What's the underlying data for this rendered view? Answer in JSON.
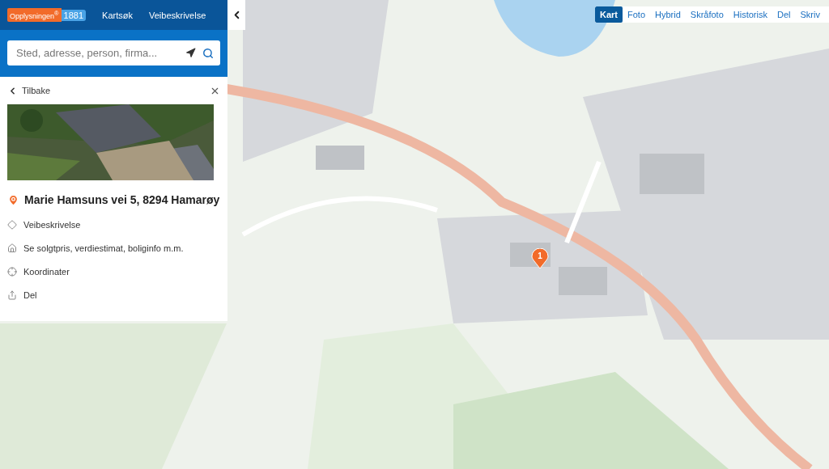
{
  "header": {
    "logo": {
      "name": "Opplysningen",
      "mark": "®",
      "number": "1881"
    },
    "nav": [
      "Kartsøk",
      "Veibeskrivelse"
    ]
  },
  "search": {
    "placeholder": "Sted, adresse, person, firma..."
  },
  "panel": {
    "back": "Tilbake",
    "address": "Marie Hamsuns vei 5, 8294 Hamarøy",
    "actions": [
      {
        "kind": "directions",
        "label": "Veibeskrivelse"
      },
      {
        "kind": "house",
        "label": "Se solgtpris, verdiestimat, boliginfo m.m."
      },
      {
        "kind": "coordinates",
        "label": "Koordinater"
      },
      {
        "kind": "share",
        "label": "Del"
      }
    ]
  },
  "map_types": [
    {
      "label": "Kart",
      "selected": true
    },
    {
      "label": "Foto",
      "selected": false
    },
    {
      "label": "Hybrid",
      "selected": false
    },
    {
      "label": "Skråfoto",
      "selected": false
    },
    {
      "label": "Historisk",
      "selected": false
    },
    {
      "label": "Del",
      "selected": false
    },
    {
      "label": "Skriv",
      "selected": false
    }
  ],
  "marker": {
    "label": "1"
  }
}
